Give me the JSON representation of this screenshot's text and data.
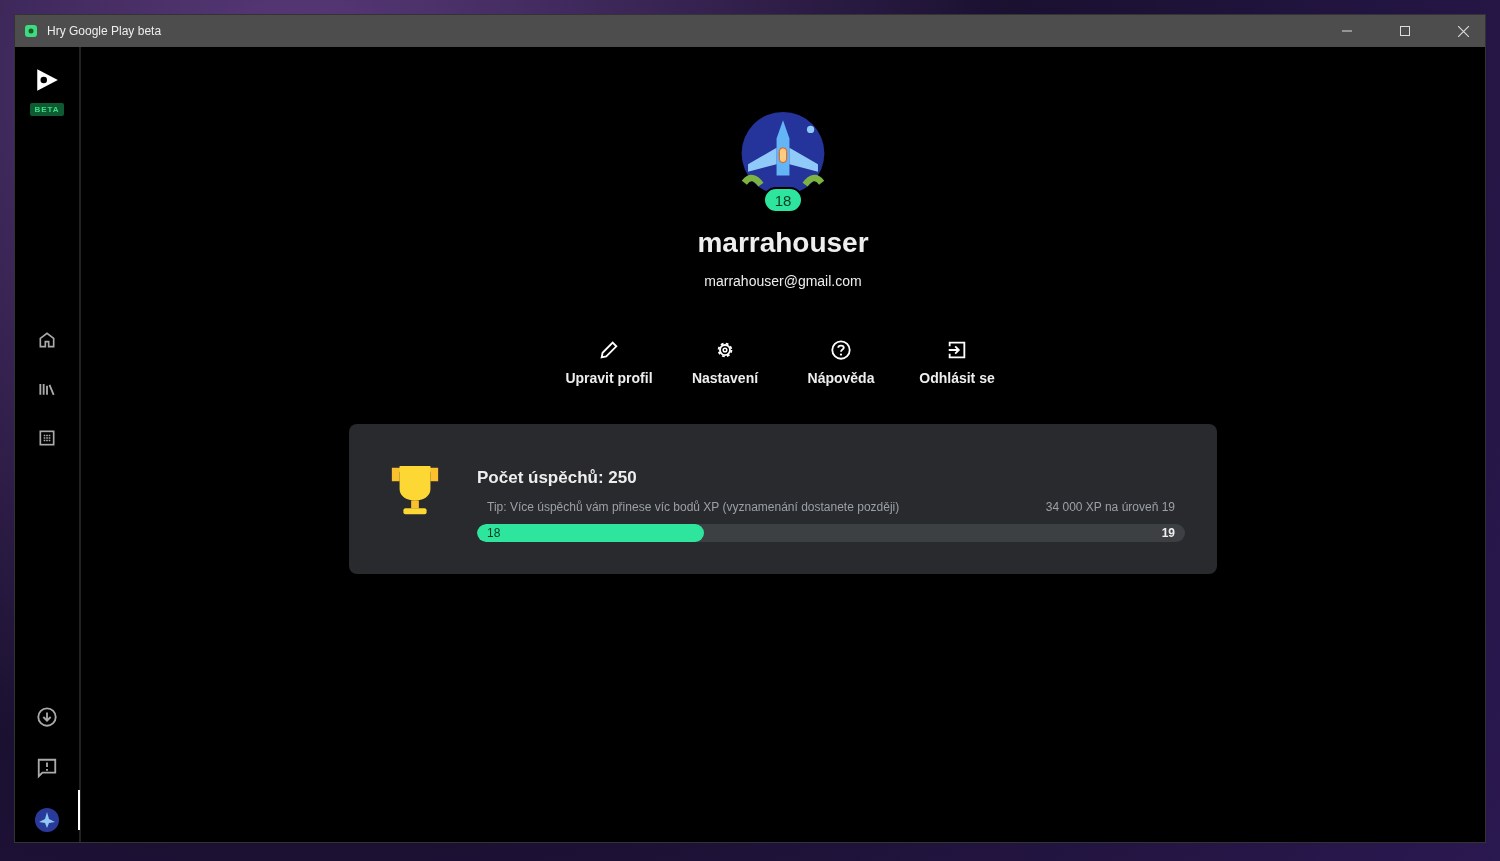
{
  "window": {
    "title": "Hry Google Play beta"
  },
  "sidebar": {
    "badge": "BETA",
    "top_items": [
      {
        "kind": "home",
        "selected": false
      },
      {
        "kind": "library",
        "selected": false
      },
      {
        "kind": "grid",
        "selected": false
      }
    ],
    "bottom_items": [
      {
        "kind": "download",
        "selected": false
      },
      {
        "kind": "feedback",
        "selected": false
      },
      {
        "kind": "avatar",
        "selected": true
      }
    ]
  },
  "profile": {
    "level": "18",
    "name": "marrahouser",
    "email": "marrahouser@gmail.com"
  },
  "actions": [
    {
      "kind": "edit",
      "label": "Upravit profil"
    },
    {
      "kind": "settings",
      "label": "Nastavení"
    },
    {
      "kind": "help",
      "label": "Nápověda"
    },
    {
      "kind": "logout",
      "label": "Odhlásit se"
    }
  ],
  "achievements": {
    "title": "Počet úspěchů: 250",
    "tip": "Tip: Více úspěchů vám přinese víc bodů XP (vyznamenání dostanete později)",
    "xp_to_next": "34 000 XP na úroveň 19",
    "current_level": "18",
    "next_level": "19",
    "level": 0.32
  }
}
